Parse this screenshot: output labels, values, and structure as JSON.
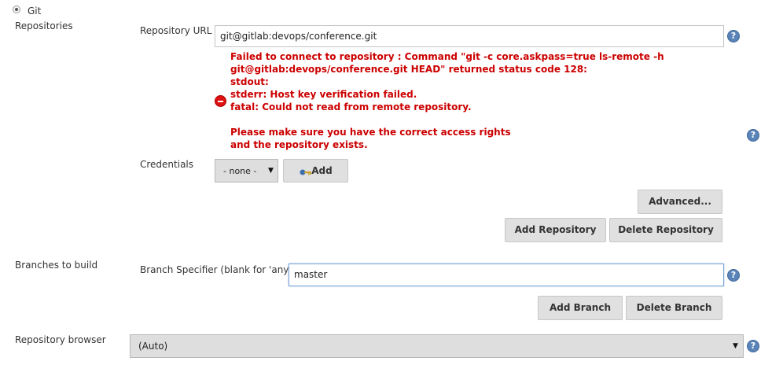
{
  "scm": {
    "git_label": "Git"
  },
  "repositories": {
    "section_label": "Repositories",
    "url_label": "Repository URL",
    "url_value": "git@gitlab:devops/conference.git",
    "error_lines": [
      "Failed to connect to repository : Command \"git -c core.askpass=true ls-remote -h",
      "git@gitlab:devops/conference.git HEAD\" returned status code 128:",
      "stdout:",
      "stderr: Host key verification failed.",
      "fatal: Could not read from remote repository.",
      "",
      "Please make sure you have the correct access rights",
      "and the repository exists."
    ],
    "credentials_label": "Credentials",
    "credentials_selected": "- none -",
    "add_credentials_label": "Add",
    "advanced_label": "Advanced...",
    "add_repository_label": "Add Repository",
    "delete_repository_label": "Delete Repository"
  },
  "branches": {
    "section_label": "Branches to build",
    "specifier_label": "Branch Specifier (blank for 'any')",
    "specifier_value": "master",
    "add_branch_label": "Add Branch",
    "delete_branch_label": "Delete Branch"
  },
  "browser": {
    "section_label": "Repository browser",
    "selected": "(Auto)"
  },
  "icons": {
    "help": "help-icon",
    "error": "error-icon",
    "key": "key-icon",
    "dropdown": "chevron-down-icon"
  },
  "colors": {
    "error_text": "#cc0000",
    "help_icon": "#5a83b8",
    "button_bg": "#e0e0e0",
    "focus_border": "#7aa6d6"
  }
}
